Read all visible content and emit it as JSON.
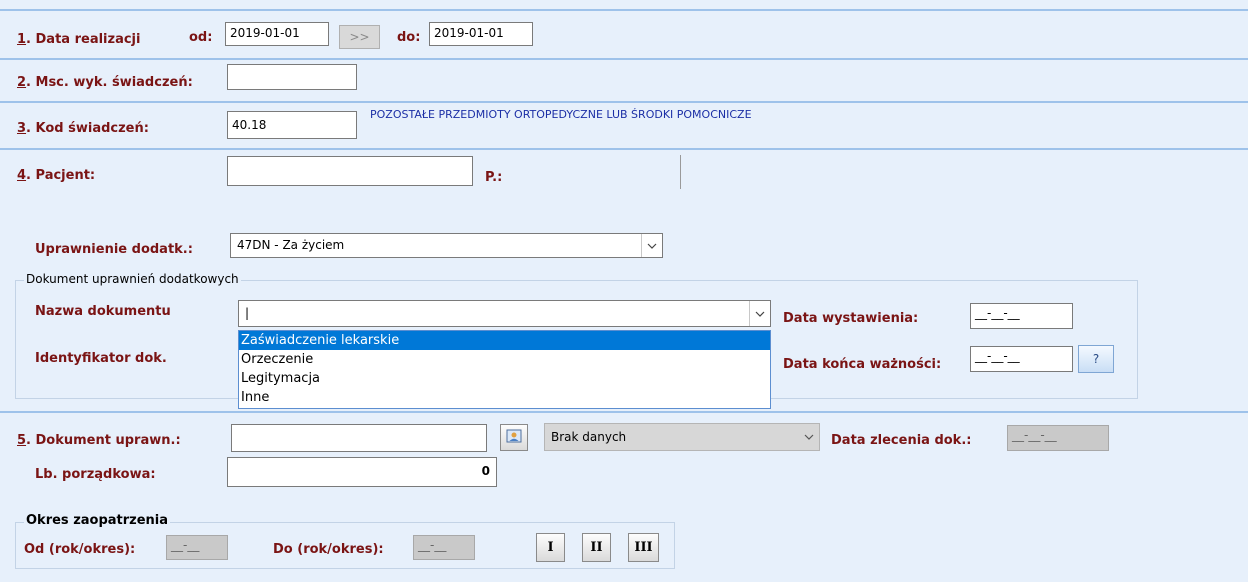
{
  "section1": {
    "num": "1",
    "label": ". Data realizacji",
    "od_label": "od:",
    "od_value": "2019-01-01",
    "arrow_button": ">>",
    "do_label": "do:",
    "do_value": "2019-01-01"
  },
  "section2": {
    "num": "2",
    "label": ". Msc. wyk. świadczeń:",
    "value": ""
  },
  "section3": {
    "num": "3",
    "label": ". Kod świadczeń:",
    "value": "40.18",
    "description": "POZOSTAŁE PRZEDMIOTY ORTOPEDYCZNE LUB ŚRODKI POMOCNICZE"
  },
  "section4": {
    "num": "4",
    "label": ". Pacjent:",
    "value": "",
    "p_label": "P.:",
    "uprawnienie_label": "Uprawnienie dodatk.:",
    "uprawnienie_value": "47DN - Za życiem",
    "group_title": "Dokument uprawnień dodatkowych",
    "nazwa_label": "Nazwa dokumentu",
    "nazwa_value": "|",
    "identyfikator_label": "Identyfikator dok.",
    "data_wystawienia_label": "Data wystawienia:",
    "data_wystawienia_value": "__-__-__",
    "data_konca_label": "Data końca ważności:",
    "data_konca_value": "__-__-__",
    "help_button": "?",
    "dropdown_options": [
      "Zaświadczenie lekarskie",
      "Orzeczenie",
      "Legitymacja",
      "Inne"
    ],
    "dropdown_selected": "Zaświadczenie lekarskie"
  },
  "section5": {
    "num": "5",
    "label": ". Dokument uprawn.:",
    "value": "",
    "status_value": "Brak danych",
    "data_zlecenia_label": "Data zlecenia dok.:",
    "data_zlecenia_value": "__-__-__",
    "lb_label": "Lb. porządkowa:",
    "lb_value": "0"
  },
  "okres": {
    "title": "Okres zaopatrzenia",
    "od_label": "Od (rok/okres):",
    "od_value": "__-__",
    "do_label": "Do (rok/okres):",
    "do_value": "__-__",
    "btn_1": "I",
    "btn_2": "II",
    "btn_3": "III"
  },
  "colors": {
    "label": "#7a1414",
    "background": "#e7f0fb",
    "separator": "#9ec2ea",
    "description": "#1c2fa6",
    "selection": "#0078d7"
  },
  "icons": {
    "combo_arrow": "chevron-down-icon",
    "lookup": "person-card-icon"
  }
}
